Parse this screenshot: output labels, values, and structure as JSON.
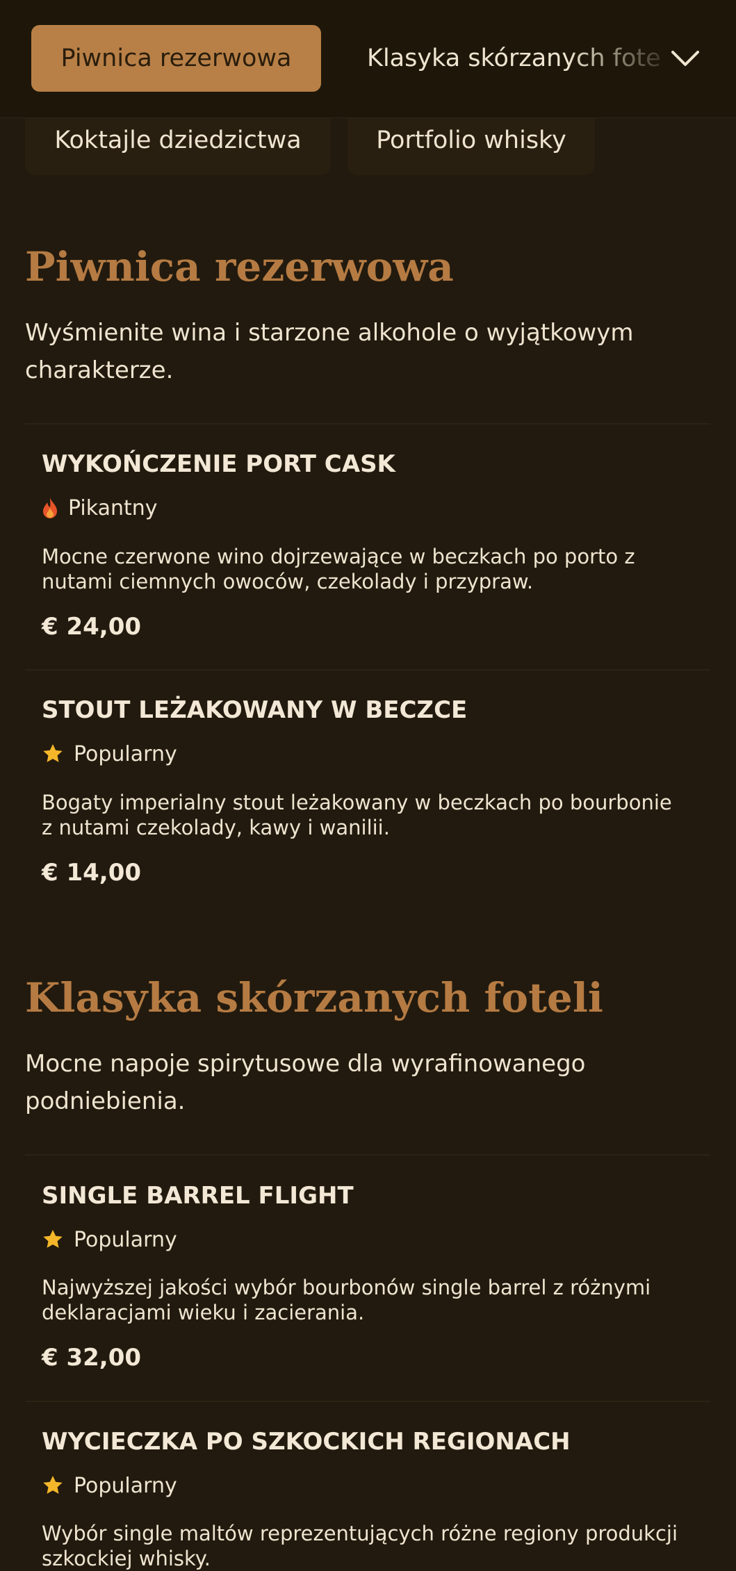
{
  "nav": {
    "active_tab": "Piwnica rezerwowa",
    "inline_tab": "Klasyka skórzanych foteli",
    "second_row": [
      "Koktajle dziedzictwa",
      "Portfolio whisky"
    ]
  },
  "sections": [
    {
      "title": "Piwnica rezerwowa",
      "description": "Wyśmienite wina i starzone alkohole o wyjątkowym charakterze.",
      "items": [
        {
          "name": "WYKOŃCZENIE PORT CASK",
          "badge": "Pikantny",
          "badge_icon": "fire-icon",
          "description": "Mocne czerwone wino dojrzewające w beczkach po porto z nutami ciemnych owoców, czekolady i przypraw.",
          "price": "€ 24,00"
        },
        {
          "name": "STOUT LEŻAKOWANY W BECZCE",
          "badge": "Popularny",
          "badge_icon": "star-icon",
          "description": "Bogaty imperialny stout leżakowany w beczkach po bourbonie z nutami czekolady, kawy i wanilii.",
          "price": "€ 14,00"
        }
      ]
    },
    {
      "title": "Klasyka skórzanych foteli",
      "description": "Mocne napoje spirytusowe dla wyrafinowanego podniebienia.",
      "items": [
        {
          "name": "SINGLE BARREL FLIGHT",
          "badge": "Popularny",
          "badge_icon": "star-icon",
          "description": "Najwyższej jakości wybór bourbonów single barrel z różnymi deklaracjami wieku i zacierania.",
          "price": "€ 32,00"
        },
        {
          "name": "WYCIECZKA PO SZKOCKICH REGIONACH",
          "badge": "Popularny",
          "badge_icon": "star-icon",
          "description": "Wybór single maltów reprezentujących różne regiony produkcji szkockiej whisky.",
          "price": ""
        }
      ]
    }
  ],
  "colors": {
    "background": "#221a0e",
    "accent": "#b88047",
    "heading": "#b57b43",
    "star": "#f4b72a",
    "fire": "#e8542a"
  }
}
